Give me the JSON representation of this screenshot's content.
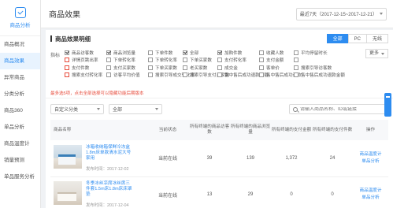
{
  "sidebar": {
    "brand": "商品分析",
    "items": [
      "商品概况",
      "商品效果",
      "异常商品",
      "分类分析",
      "商品360",
      "单品分析",
      "商品温度计",
      "销量预测",
      "单品服务分析"
    ],
    "active_index": 1
  },
  "header": {
    "title": "商品效果",
    "date_range": "最近7天（2017-12-15~2017-12-21）"
  },
  "card": {
    "title": "商品效果明细",
    "tabs": [
      "全部",
      "PC",
      "无线"
    ],
    "active_tab": 0,
    "metrics_label": "指标",
    "more_button": "更多",
    "metrics": [
      {
        "label": "商品访客数",
        "checked": true
      },
      {
        "label": "商品浏览量",
        "checked": true
      },
      {
        "label": "下单件数",
        "checked": false
      },
      {
        "label": "全部",
        "checked": true
      },
      {
        "label": "加购件数",
        "checked": true
      },
      {
        "label": "收藏人数",
        "checked": false
      },
      {
        "label": "平均停留时长",
        "checked": false
      },
      {
        "label": "详情页跳出率",
        "checked": false
      },
      {
        "label": "下单转化率",
        "checked": false
      },
      {
        "label": "下单转化率",
        "checked": false
      },
      {
        "label": "下单买家数",
        "checked": false
      },
      {
        "label": "支付转化率",
        "checked": false
      },
      {
        "label": "支付金额",
        "checked": false
      },
      {
        "label": "",
        "checked": false
      },
      {
        "label": "支付件数",
        "checked": false
      },
      {
        "label": "支付买家数",
        "checked": false
      },
      {
        "label": "下单买家数",
        "checked": false
      },
      {
        "label": "老买家数",
        "checked": false
      },
      {
        "label": "成交金",
        "checked": false
      },
      {
        "label": "客单价",
        "checked": false
      },
      {
        "label": "搜索引导访客数",
        "checked": false
      },
      {
        "label": "搜索支付转化率",
        "checked": false
      },
      {
        "label": "访客平均价值",
        "checked": false
      },
      {
        "label": "搜索引导成交转化率",
        "checked": false
      },
      {
        "label": "搜索引导支付买家数",
        "checked": false
      },
      {
        "label": "售中售后成功退款金额",
        "checked": false
      },
      {
        "label": "售中售后成功退款",
        "checked": false
      },
      {
        "label": "售中售后成功退款金额",
        "checked": false
      }
    ],
    "notice": "最多选5项，点击全部选择可以隐藏功能后期版本",
    "filters": {
      "select1": "自定义分类",
      "select2": "全部",
      "search_placeholder": "请输入商品名称、ID或链接"
    },
    "table": {
      "headers": [
        "商品名称",
        "当前状态",
        "所有终端的商品访客数",
        "所有终端的商品浏览量",
        "所有终端的支付金额",
        "所有终端的支付件数",
        "操作"
      ],
      "rows": [
        {
          "name": "冰箱收纳箱保鲜冷冻盒1.8m床单款清水泥大号家用",
          "time": "发布时间：2017-12-02",
          "status": "当前在线",
          "visitors": "39",
          "views": "139",
          "payment": "1,372",
          "items": "24",
          "ops": [
            "商品温度计",
            "单品分析"
          ]
        },
        {
          "name": "冬季冰丝凉席冰丝席三件套1.5m床1.8m床床罩垫",
          "time": "发布时间：2017-12-04",
          "status": "当前在线",
          "visitors": "13",
          "views": "29",
          "payment": "0",
          "items": "0",
          "ops": [
            "商品温度计",
            "单品分析"
          ]
        }
      ]
    }
  },
  "colors": {
    "accent": "#2d8cf0",
    "warning": "#e74c3c"
  }
}
